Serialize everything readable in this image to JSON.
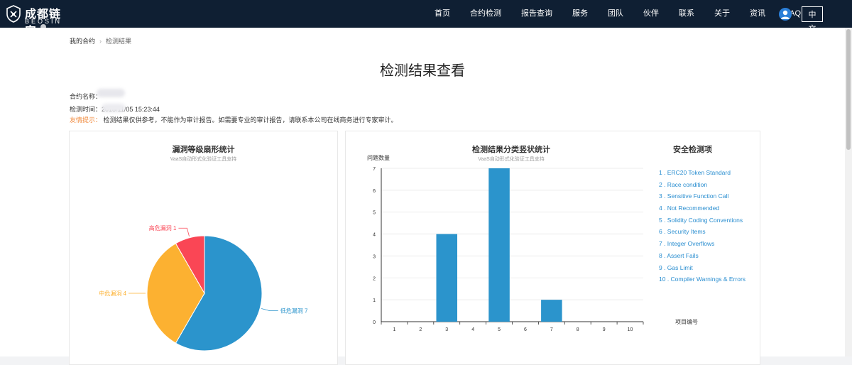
{
  "brand": {
    "title": "成都链安",
    "subtitle": "BEOSIN"
  },
  "nav": {
    "items": [
      "首页",
      "合约检测",
      "报告查询",
      "服务",
      "团队",
      "伙伴",
      "联系",
      "关于",
      "资讯",
      "FAQ"
    ],
    "lang": "中文"
  },
  "breadcrumb": {
    "root": "我的合约",
    "sep": "›",
    "current": "检测结果"
  },
  "page": {
    "title": "检测结果查看",
    "contract_label": "合约名称：",
    "time_label": "检测时间：",
    "time_value": "2018/11/05 15:23:44",
    "tip_label": "友情提示：",
    "tip_text": "检测结果仅供参考，不能作为审计报告。如需要专业的审计报告，请联系本公司在线商务进行专家审计。"
  },
  "pie_panel": {
    "title": "漏洞等级扇形统计",
    "subtitle": "VaaS自动形式化验证工具支持"
  },
  "bar_panel": {
    "title": "检测结果分类竖状统计",
    "subtitle": "VaaS自动形式化验证工具支持"
  },
  "security_panel": {
    "title": "安全检测项",
    "items": [
      "1 . ERC20 Token Standard",
      "2 . Race condition",
      "3 . Sensitive Function Call",
      "4 . Not Recommended",
      "5 . Solidity Coding Conventions",
      "6 . Security Items",
      "7 . Integer Overflows",
      "8 . Assert Fails",
      "9 . Gas Limit",
      "10 . Compiler Warnings & Errors"
    ]
  },
  "chart_data": [
    {
      "type": "pie",
      "title": "漏洞等级扇形统计",
      "subtitle": "VaaS自动形式化验证工具支持",
      "slices": [
        {
          "label": "低危漏洞 7",
          "value": 7,
          "color": "#2b94cc"
        },
        {
          "label": "中危漏洞 4",
          "value": 4,
          "color": "#fcb131"
        },
        {
          "label": "高危漏洞 1",
          "value": 1,
          "color": "#fa4655"
        }
      ]
    },
    {
      "type": "bar",
      "title": "检测结果分类竖状统计",
      "subtitle": "VaaS自动形式化验证工具支持",
      "ylabel": "问题数量",
      "xlabel": "项目编号",
      "categories": [
        "1",
        "2",
        "3",
        "4",
        "5",
        "6",
        "7",
        "8",
        "9",
        "10"
      ],
      "values": [
        0,
        0,
        4,
        0,
        7,
        0,
        1,
        0,
        0,
        0
      ],
      "ylim": [
        0,
        7
      ],
      "yticks": [
        0,
        1,
        2,
        3,
        4,
        5,
        6,
        7
      ],
      "grid": true,
      "color": "#2b94cc"
    }
  ]
}
